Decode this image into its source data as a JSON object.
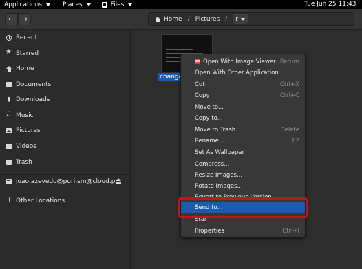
{
  "topbar": {
    "applications": "Applications",
    "places": "Places",
    "files": "Files",
    "clock": "Tue Jun 25  11:43"
  },
  "header": {
    "back": "←",
    "forward": "→",
    "path": [
      "Home",
      "Pictures",
      "r"
    ],
    "separator": "/"
  },
  "sidebar": {
    "items": [
      {
        "label": "Recent",
        "icon": "clock-icon"
      },
      {
        "label": "Starred",
        "icon": "star-icon"
      },
      {
        "label": "Home",
        "icon": "home-icon"
      },
      {
        "label": "Documents",
        "icon": "document-icon"
      },
      {
        "label": "Downloads",
        "icon": "download-icon"
      },
      {
        "label": "Music",
        "icon": "music-icon"
      },
      {
        "label": "Pictures",
        "icon": "picture-icon"
      },
      {
        "label": "Videos",
        "icon": "video-icon"
      },
      {
        "label": "Trash",
        "icon": "trash-icon"
      },
      {
        "label": "joao.azevedo@puri.sm@cloud.p...",
        "icon": "network-drive-icon"
      },
      {
        "label": "Other Locations",
        "icon": "plus-icon"
      }
    ]
  },
  "main": {
    "file_label": "change-"
  },
  "context_menu": {
    "items": [
      {
        "label": "Open With Image Viewer",
        "accel": "Return"
      },
      {
        "label": "Open With Other Application",
        "accel": ""
      },
      {
        "label": "Cut",
        "accel": "Ctrl+X"
      },
      {
        "label": "Copy",
        "accel": "Ctrl+C"
      },
      {
        "label": "Move to...",
        "accel": ""
      },
      {
        "label": "Copy to...",
        "accel": ""
      },
      {
        "label": "Move to Trash",
        "accel": "Delete"
      },
      {
        "label": "Rename...",
        "accel": "F2"
      },
      {
        "label": "Set As Wallpaper",
        "accel": ""
      },
      {
        "label": "Compress...",
        "accel": ""
      },
      {
        "label": "Resize Images...",
        "accel": ""
      },
      {
        "label": "Rotate Images...",
        "accel": ""
      },
      {
        "label": "Revert to Previous Version",
        "accel": ""
      },
      {
        "label": "Send to...",
        "accel": ""
      },
      {
        "label": "Star",
        "accel": ""
      },
      {
        "label": "Properties",
        "accel": "Ctrl+I"
      }
    ]
  },
  "colors": {
    "selection": "#1b5ab1",
    "highlight_ring": "#c2161c"
  }
}
